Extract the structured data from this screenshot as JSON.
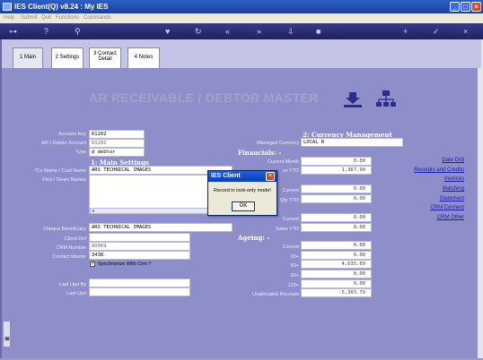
{
  "window": {
    "title": "IES Client(Q) v8.24 : My IES"
  },
  "menu": {
    "items": [
      "Help",
      "Submit",
      "Quit",
      "Functions",
      "Commands"
    ]
  },
  "tabs": [
    {
      "label": "1 Main"
    },
    {
      "label": "2 Settings"
    },
    {
      "label": "3 Contact Detail"
    },
    {
      "label": "4 Notes"
    }
  ],
  "heading": "AR RECEIVABLE / DEBTOR MASTER",
  "left": {
    "account_key_label": "Account Key",
    "account_key": "01202",
    "debtor_account_label": "AR / Debtor Account",
    "debtor_account": "01202",
    "type_label": "Type",
    "type": "d debtor",
    "main_settings": "1: Main Settings",
    "co_name_label": "*Co Name / Cust Name",
    "co_name": "ARS TECHNICAL IMAGES",
    "first_names_label": "First / Given Names",
    "cheque_label": "Cheque Beneficiary",
    "cheque": "ARS TECHNICAL IMAGES",
    "client_ref_label": "Client Ref",
    "crm_number_label": "CRM Number",
    "crm_number": "00069",
    "contact_master_label": "Contact Master",
    "contact_master": "3438",
    "sync_label": "Synchronize With Crm ?",
    "last_upd_by_label": "Last Upd By",
    "last_upd_label": "Last Upd"
  },
  "right": {
    "currency_mgmt": "2: Currency Management",
    "managed_currency_label": "Managed Currency",
    "managed_currency": "LOCAL R",
    "financials": "Financials: -",
    "current_month_label": "Current Month",
    "current_month": "0.00",
    "ytd_label": "ce YTD",
    "ytd": "1,367.90",
    "current_label": "Current",
    "current": "0.00",
    "qty_ytd_label": "Qty YTD",
    "qty_ytd": "0.00",
    "current2_label": "Current",
    "current2": "0.00",
    "sales_ytd_label": "Sales YTD",
    "sales_ytd": "0.00",
    "ageing": "Ageing: -",
    "age_current_label": "Current",
    "age_current": "0.00",
    "age30_label": "30+",
    "age30": "0.00",
    "age60_label": "60+",
    "age60": "4,635.69",
    "age90_label": "90+",
    "age90": "0.00",
    "age120_label": "120+",
    "age120": "0.00",
    "unalloc_label": "Unallocated Receipts",
    "unalloc": "-5,303.79"
  },
  "links": [
    "Date Drill",
    "Receipts and Credits",
    "Invoices",
    "Matching",
    "Statement",
    "CRM Connect",
    "CRM Other"
  ],
  "dialog": {
    "title": "IES Client",
    "message": "Record in look-only mode!",
    "ok": "OK"
  },
  "colors": {
    "title_bar": "#1c3f9c",
    "background": "#8e8ecb",
    "link": "#1a1aa8"
  }
}
